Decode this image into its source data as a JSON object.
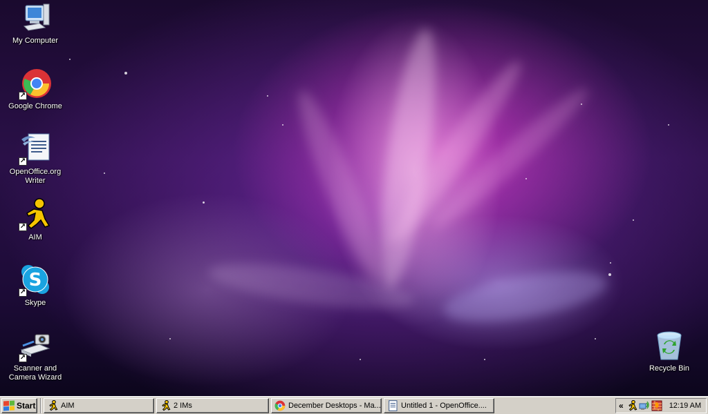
{
  "desktop": {
    "icons": [
      {
        "label": "My Computer",
        "icon": "my-computer-icon"
      },
      {
        "label": "Google Chrome",
        "icon": "chrome-icon"
      },
      {
        "label": "OpenOffice.org Writer",
        "icon": "openoffice-writer-icon"
      },
      {
        "label": "AIM",
        "icon": "aim-icon"
      },
      {
        "label": "Skype",
        "icon": "skype-icon"
      },
      {
        "label": "Scanner and Camera Wizard",
        "icon": "scanner-camera-icon"
      },
      {
        "label": "Recycle Bin",
        "icon": "recycle-bin-icon"
      }
    ]
  },
  "taskbar": {
    "start_label": "Start",
    "tasks": [
      {
        "label": "AIM",
        "icon": "aim-icon"
      },
      {
        "label": "2 IMs",
        "icon": "aim-icon"
      },
      {
        "label": "December Desktops - Ma...",
        "icon": "chrome-icon"
      },
      {
        "label": "Untitled 1 - OpenOffice....",
        "icon": "openoffice-writer-icon"
      }
    ],
    "tray": {
      "chevron": "«",
      "icons": [
        "aim-tray-icon",
        "network-icon",
        "firewall-icon"
      ],
      "clock": "12:19 AM"
    }
  },
  "colors": {
    "taskbar": "#d4d0c8",
    "aim_yellow": "#f5c400",
    "skype_blue": "#1aa3e0"
  }
}
